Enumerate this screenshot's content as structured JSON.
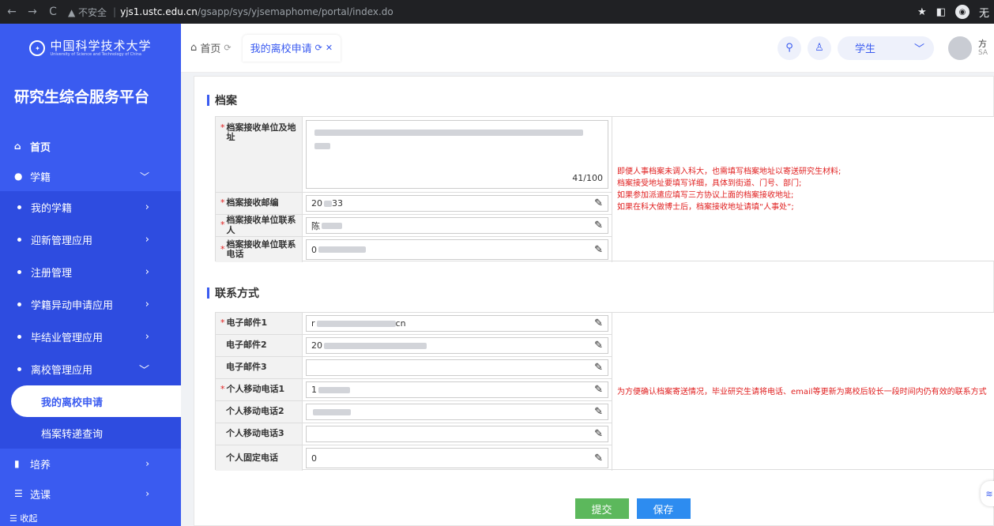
{
  "browser": {
    "back": "←",
    "forward": "→",
    "reload": "C",
    "warn_label": "▲ 不安全",
    "url_host": "yjs1.ustc.edu.cn",
    "url_path": "/gsapp/sys/yjsemaphome/portal/index.do",
    "profile_label": "无"
  },
  "sidebar": {
    "logo_cn": "中国科学技术大学",
    "logo_en": "University of Science and Technology of China",
    "platform_title": "研究生综合服务平台",
    "home_label": "首页",
    "xueji_label": "学籍",
    "sub_items": [
      "我的学籍",
      "迎新管理应用",
      "注册管理",
      "学籍异动申请应用",
      "毕结业管理应用",
      "离校管理应用"
    ],
    "leaf_items": [
      "我的离校申请",
      "档案转递查询"
    ],
    "peiyang_label": "培养",
    "xuanke_label": "选课",
    "collapse_label": "收起"
  },
  "topbar": {
    "home_tab": "首页",
    "active_tab": "我的离校申请",
    "role": "学生",
    "user_name": "方",
    "user_sub": "SA"
  },
  "archive": {
    "title": "档案",
    "address_label": "档案接收单位及地址",
    "address_count": "41/100",
    "zip_label": "档案接收邮编",
    "zip_value_a": "20",
    "zip_value_b": "33",
    "contact_label": "档案接收单位联系人",
    "contact_value": "陈",
    "phone_label": "档案接收单位联系电话",
    "phone_value": "0",
    "notes": [
      "即便人事档案未调入科大，也需填写档案地址以寄送研究生材料;",
      "档案接受地址要填写详细，具体到街道、门号、部门;",
      "如果参加派遣应填写三方协议上面的档案接收地址;",
      "如果在科大做博士后，档案接收地址请填“人事处”;"
    ]
  },
  "contact": {
    "title": "联系方式",
    "email1_label": "电子邮件1",
    "email1_value_a": "r",
    "email1_value_b": "cn",
    "email2_label": "电子邮件2",
    "email2_value": "20",
    "email3_label": "电子邮件3",
    "mobile1_label": "个人移动电话1",
    "mobile1_value": "1",
    "mobile2_label": "个人移动电话2",
    "mobile3_label": "个人移动电话3",
    "landline_label": "个人固定电话",
    "landline_value": "0",
    "note": "为方便确认档案寄送情况，毕业研究生请将电话、email等更新为离校后较长一段时间内仍有效的联系方式"
  },
  "actions": {
    "submit": "提交",
    "save": "保存"
  }
}
